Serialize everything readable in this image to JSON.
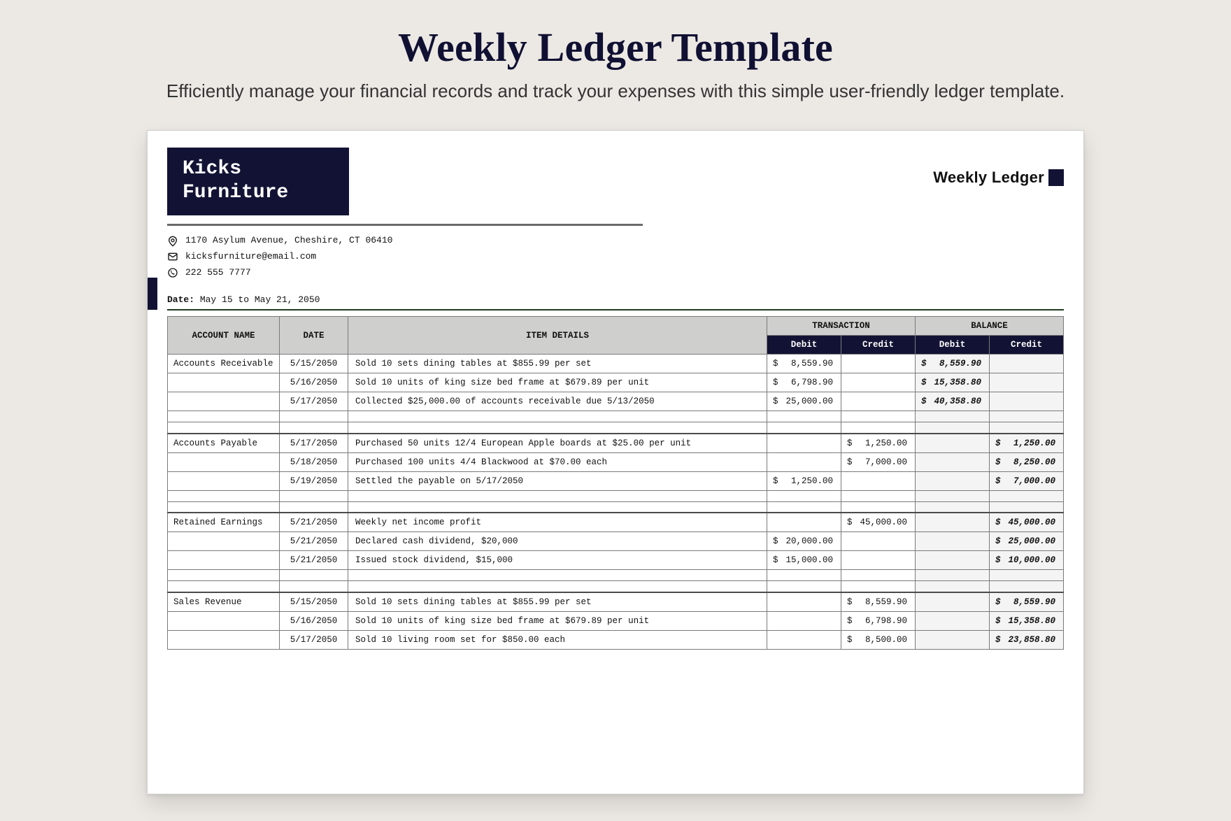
{
  "headline": "Weekly Ledger Template",
  "subtitle": "Efficiently manage your financial records and track your expenses with this simple user-friendly ledger template.",
  "brand": {
    "line1": "Kicks",
    "line2": "Furniture"
  },
  "weekly_ledger_label": "Weekly Ledger",
  "contact": {
    "address": "1170 Asylum Avenue, Cheshire, CT 06410",
    "email": "kicksfurniture@email.com",
    "phone": "222 555 7777"
  },
  "date_label": "Date:",
  "date_range": "May 15 to May 21, 2050",
  "columns": {
    "account": "ACCOUNT NAME",
    "date": "DATE",
    "item": "ITEM DETAILS",
    "transaction": "TRANSACTION",
    "balance": "BALANCE",
    "debit": "Debit",
    "credit": "Credit"
  },
  "groups": [
    {
      "account": "Accounts Receivable",
      "rows": [
        {
          "date": "5/15/2050",
          "item": "Sold 10 sets dining tables at $855.99 per set",
          "t_debit": "8,559.90",
          "t_credit": "",
          "b_debit": "8,559.90",
          "b_credit": ""
        },
        {
          "date": "5/16/2050",
          "item": "Sold 10 units of king size bed frame at $679.89 per unit",
          "t_debit": "6,798.90",
          "t_credit": "",
          "b_debit": "15,358.80",
          "b_credit": ""
        },
        {
          "date": "5/17/2050",
          "item": "Collected $25,000.00 of accounts receivable due 5/13/2050",
          "t_debit": "25,000.00",
          "t_credit": "",
          "b_debit": "40,358.80",
          "b_credit": ""
        }
      ]
    },
    {
      "account": "Accounts Payable",
      "rows": [
        {
          "date": "5/17/2050",
          "item": "Purchased 50 units 12/4 European Apple boards at $25.00 per unit",
          "t_debit": "",
          "t_credit": "1,250.00",
          "b_debit": "",
          "b_credit": "1,250.00"
        },
        {
          "date": "5/18/2050",
          "item": "Purchased 100 units 4/4 Blackwood at $70.00 each",
          "t_debit": "",
          "t_credit": "7,000.00",
          "b_debit": "",
          "b_credit": "8,250.00"
        },
        {
          "date": "5/19/2050",
          "item": "Settled the payable on 5/17/2050",
          "t_debit": "1,250.00",
          "t_credit": "",
          "b_debit": "",
          "b_credit": "7,000.00"
        }
      ]
    },
    {
      "account": "Retained Earnings",
      "rows": [
        {
          "date": "5/21/2050",
          "item": "Weekly net income profit",
          "t_debit": "",
          "t_credit": "45,000.00",
          "b_debit": "",
          "b_credit": "45,000.00"
        },
        {
          "date": "5/21/2050",
          "item": "Declared cash dividend, $20,000",
          "t_debit": "20,000.00",
          "t_credit": "",
          "b_debit": "",
          "b_credit": "25,000.00"
        },
        {
          "date": "5/21/2050",
          "item": "Issued stock dividend, $15,000",
          "t_debit": "15,000.00",
          "t_credit": "",
          "b_debit": "",
          "b_credit": "10,000.00"
        }
      ]
    },
    {
      "account": "Sales Revenue",
      "rows": [
        {
          "date": "5/15/2050",
          "item": "Sold 10 sets dining tables at $855.99 per set",
          "t_debit": "",
          "t_credit": "8,559.90",
          "b_debit": "",
          "b_credit": "8,559.90"
        },
        {
          "date": "5/16/2050",
          "item": "Sold 10 units of king size bed frame at $679.89 per unit",
          "t_debit": "",
          "t_credit": "6,798.90",
          "b_debit": "",
          "b_credit": "15,358.80"
        },
        {
          "date": "5/17/2050",
          "item": "Sold 10 living room set for $850.00 each",
          "t_debit": "",
          "t_credit": "8,500.00",
          "b_debit": "",
          "b_credit": "23,858.80"
        }
      ]
    }
  ]
}
